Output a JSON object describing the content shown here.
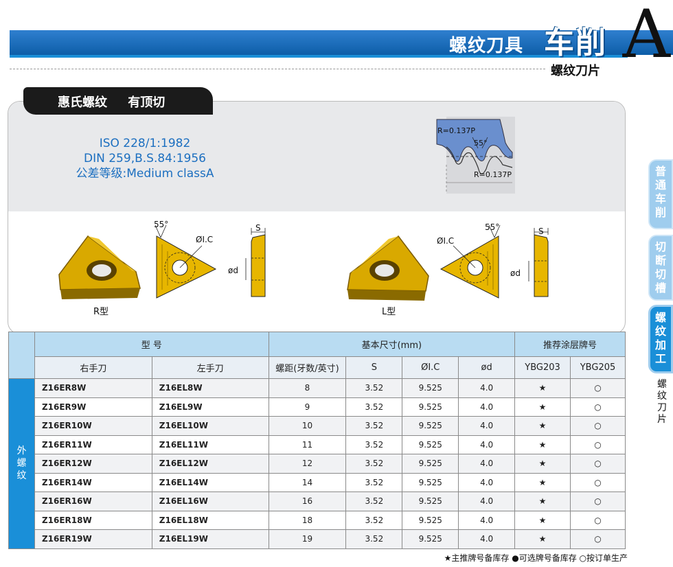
{
  "header": {
    "title": "螺纹刀具",
    "category": "车削",
    "section_letter": "A",
    "subtitle": "螺纹刀片"
  },
  "panel": {
    "tag_left": "惠氏螺纹",
    "tag_right": "有顶切",
    "standards": [
      "ISO 228/1:1982",
      "DIN 259,B.S.84:1956",
      "公差等级:Medium classA"
    ]
  },
  "thread_profile": {
    "radius_top": "R=0.137P",
    "angle": "55°",
    "radius_bottom": "R=0.137P"
  },
  "diagrams": {
    "angle": "55°",
    "ic_label": "ØI.C",
    "s_label": "S",
    "d_label": "ød",
    "r_type": "R型",
    "l_type": "L型"
  },
  "table": {
    "group_headers": {
      "model": "型 号",
      "dimensions": "基本尺寸(mm)",
      "coating": "推荐涂层牌号"
    },
    "columns": [
      "右手刀",
      "左手刀",
      "螺距(牙数/英寸)",
      "S",
      "ØI.C",
      "ød",
      "YBG203",
      "YBG205"
    ],
    "side_label": "外螺纹",
    "rows": [
      {
        "r": "Z16ER8W",
        "l": "Z16EL8W",
        "pitch": "8",
        "s": "3.52",
        "ic": "9.525",
        "d": "4.0",
        "ybg203": "★",
        "ybg205": "○"
      },
      {
        "r": "Z16ER9W",
        "l": "Z16EL9W",
        "pitch": "9",
        "s": "3.52",
        "ic": "9.525",
        "d": "4.0",
        "ybg203": "★",
        "ybg205": "○"
      },
      {
        "r": "Z16ER10W",
        "l": "Z16EL10W",
        "pitch": "10",
        "s": "3.52",
        "ic": "9.525",
        "d": "4.0",
        "ybg203": "★",
        "ybg205": "○"
      },
      {
        "r": "Z16ER11W",
        "l": "Z16EL11W",
        "pitch": "11",
        "s": "3.52",
        "ic": "9.525",
        "d": "4.0",
        "ybg203": "★",
        "ybg205": "○"
      },
      {
        "r": "Z16ER12W",
        "l": "Z16EL12W",
        "pitch": "12",
        "s": "3.52",
        "ic": "9.525",
        "d": "4.0",
        "ybg203": "★",
        "ybg205": "○"
      },
      {
        "r": "Z16ER14W",
        "l": "Z16EL14W",
        "pitch": "14",
        "s": "3.52",
        "ic": "9.525",
        "d": "4.0",
        "ybg203": "★",
        "ybg205": "○"
      },
      {
        "r": "Z16ER16W",
        "l": "Z16EL16W",
        "pitch": "16",
        "s": "3.52",
        "ic": "9.525",
        "d": "4.0",
        "ybg203": "★",
        "ybg205": "○"
      },
      {
        "r": "Z16ER18W",
        "l": "Z16EL18W",
        "pitch": "18",
        "s": "3.52",
        "ic": "9.525",
        "d": "4.0",
        "ybg203": "★",
        "ybg205": "○"
      },
      {
        "r": "Z16ER19W",
        "l": "Z16EL19W",
        "pitch": "19",
        "s": "3.52",
        "ic": "9.525",
        "d": "4.0",
        "ybg203": "★",
        "ybg205": "○"
      }
    ]
  },
  "footer": "★主推牌号备库存   ●可选牌号备库存   ○按订单生产",
  "side_tabs": [
    "普通车削",
    "切断切槽",
    "螺纹加工"
  ],
  "side_sub": "螺纹刀片",
  "colors": {
    "brand_blue": "#1a8fd8",
    "insert_gold": "#e7b600",
    "header_blue": "#b9dcf2"
  }
}
